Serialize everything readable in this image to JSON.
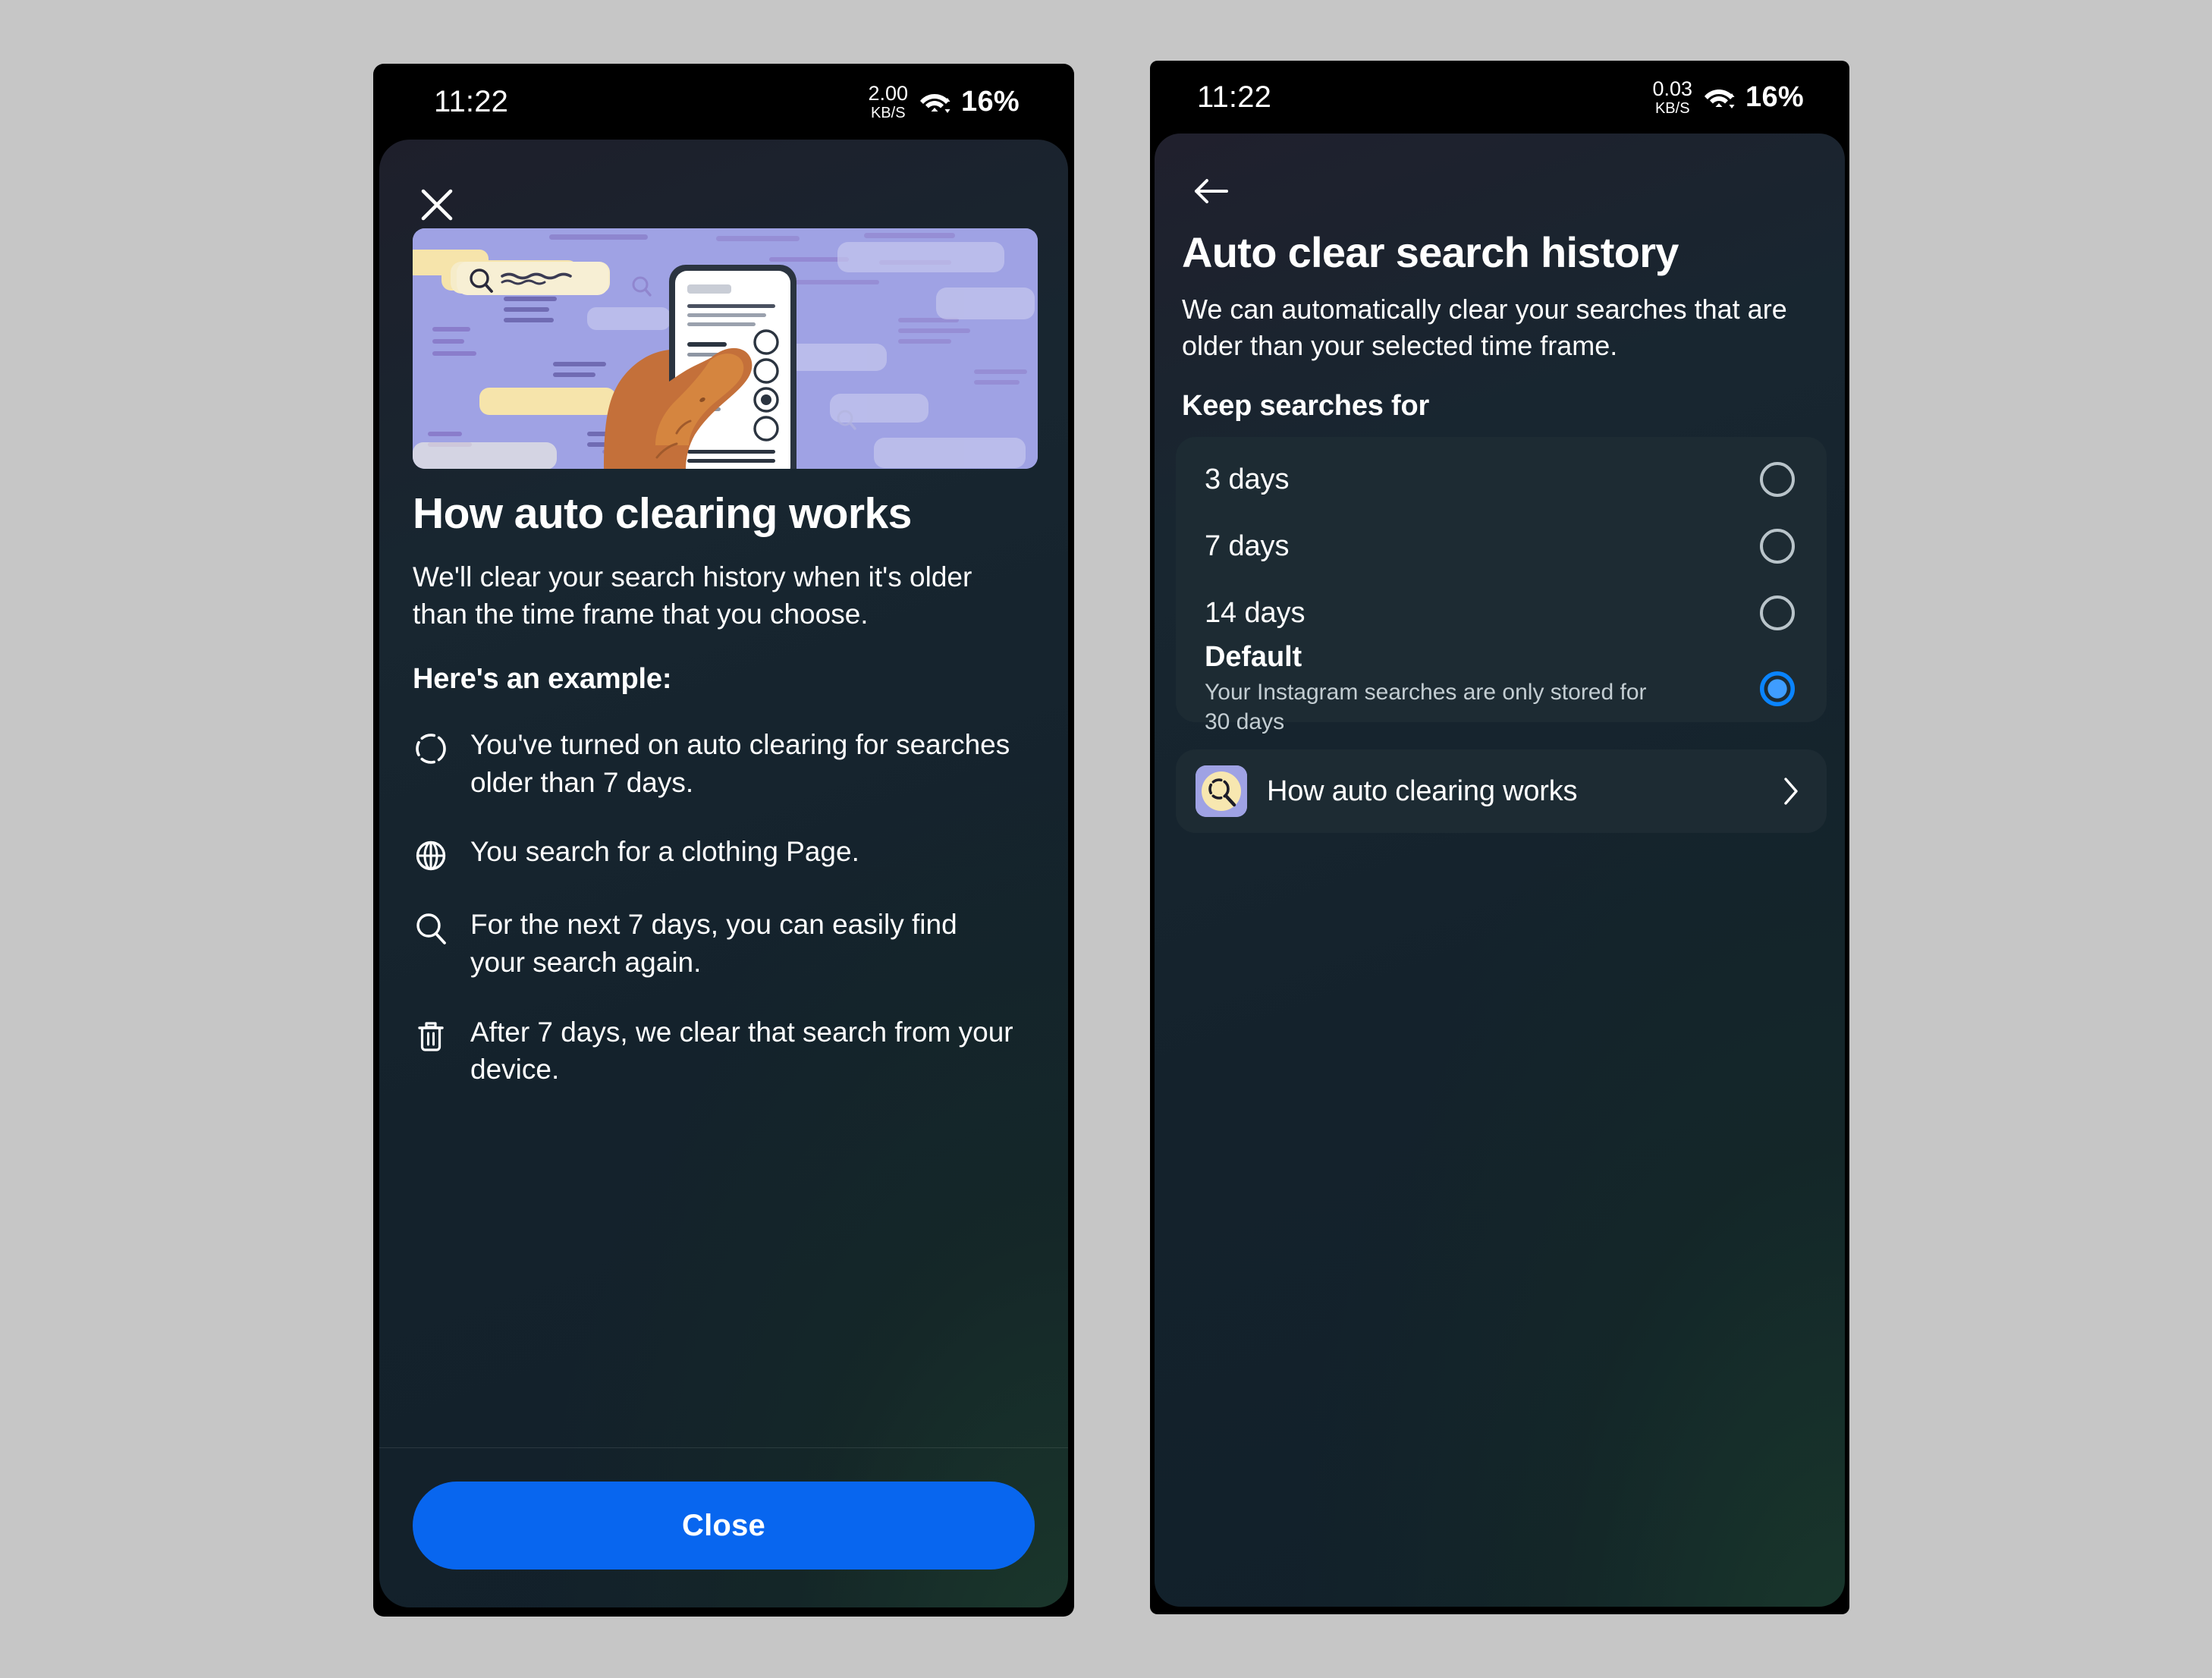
{
  "left_phone": {
    "status_bar": {
      "time": "11:22",
      "net_speed_value": "2.00",
      "net_speed_unit": "KB/S",
      "wifi_icon": "wifi-icon",
      "battery": "16%"
    },
    "close_icon": "close-icon",
    "hero_illustration": "hand-holding-phone-search-settings-illustration",
    "heading": "How auto clearing works",
    "subtitle": "We'll clear your search history when it's older than the time frame that you choose.",
    "example_heading": "Here's an example:",
    "bullets": [
      {
        "icon": "dashed-circle-icon",
        "text": "You've turned on auto clearing for searches older than 7 days."
      },
      {
        "icon": "globe-icon",
        "text": "You search for a clothing Page."
      },
      {
        "icon": "search-icon",
        "text": "For the next 7 days, you can easily find your search again."
      },
      {
        "icon": "trash-icon",
        "text": "After 7 days, we clear that search from your device."
      }
    ],
    "close_button_label": "Close"
  },
  "right_phone": {
    "status_bar": {
      "time": "11:22",
      "net_speed_value": "0.03",
      "net_speed_unit": "KB/S",
      "wifi_icon": "wifi-icon",
      "battery": "16%"
    },
    "back_icon": "back-arrow-icon",
    "title": "Auto clear search history",
    "subtitle": "We can automatically clear your searches that are older than your selected time frame.",
    "section_label": "Keep searches for",
    "options": [
      {
        "label": "3 days",
        "description": "",
        "selected": false
      },
      {
        "label": "7 days",
        "description": "",
        "selected": false
      },
      {
        "label": "14 days",
        "description": "",
        "selected": false
      },
      {
        "label": "Default",
        "description": "Your Instagram searches are only stored for 30 days",
        "selected": true
      }
    ],
    "link_row": {
      "thumb_icon": "search-clock-thumbnail-icon",
      "label": "How auto clearing works",
      "chevron_icon": "chevron-right-icon"
    }
  },
  "colors": {
    "accent_blue": "#0866ef",
    "radio_selected": "#0a84ff",
    "card_bg": "#1d2b33",
    "page_bg_top": "#1e1f2b",
    "page_bg_bottom": "#11202a",
    "illustration_bg": "#9a9de0",
    "thumb_accent": "#f6e4ab"
  }
}
